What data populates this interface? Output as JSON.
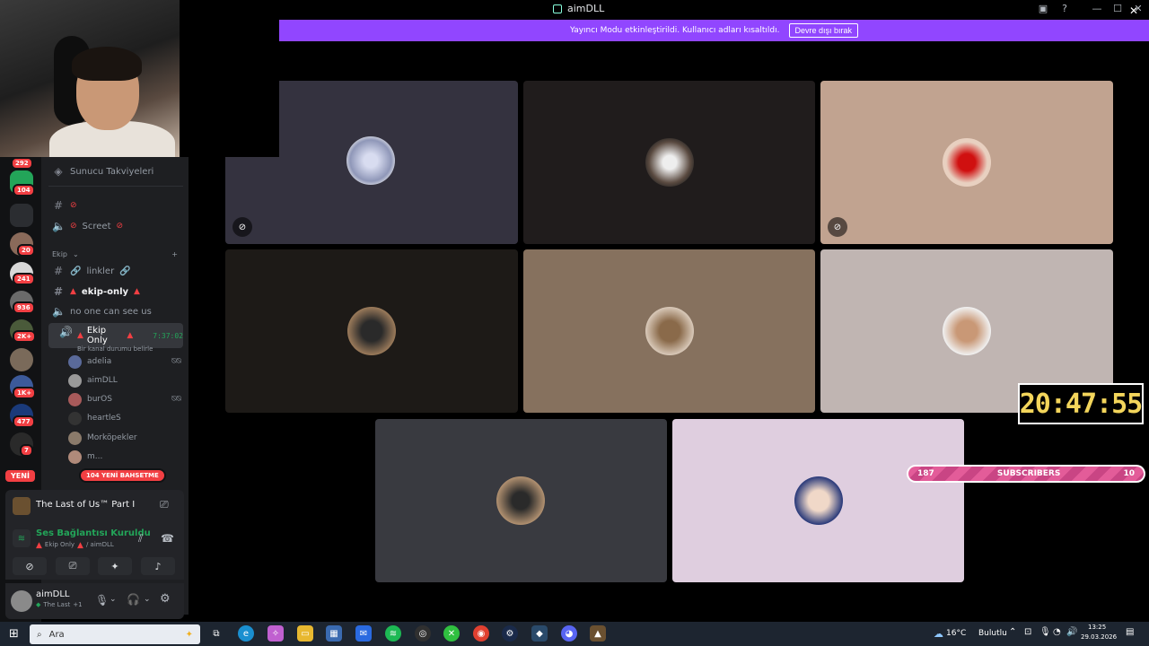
{
  "window": {
    "title": "aimDLL"
  },
  "banner": {
    "message": "Yayıncı Modu etkinleştirildi. Kullanıcı adları kısaltıldı.",
    "button": "Devre dışı bırak"
  },
  "rail": {
    "badges": [
      "292",
      "104",
      "20",
      "241",
      "936",
      "2K+",
      "1K+",
      "477",
      "7"
    ],
    "new_label": "YENİ"
  },
  "sidebar": {
    "boosts": "Sunucu Takviyeleri",
    "category": "Ekip",
    "channels": [
      {
        "name": "",
        "type": "text"
      },
      {
        "name": "Screet",
        "type": "voice"
      },
      {
        "name": "linkler",
        "type": "text"
      },
      {
        "name": "ekip-only",
        "type": "text"
      },
      {
        "name": "no one can see us",
        "type": "voice"
      }
    ],
    "active_voice": {
      "name": "Ekip Only",
      "timer": "7:37:02",
      "status": "Bir kanal durumu belirle"
    },
    "users": [
      "adelia",
      "aimDLL",
      "burOS",
      "heartleS",
      "Morköpekler",
      "m..."
    ],
    "mentions": "104 YENİ BAHSETME"
  },
  "game": {
    "title": "The Last of Us™ Part I"
  },
  "voice": {
    "status": "Ses Bağlantısı Kuruldu",
    "channel": "Ekip Only",
    "server": "/ aimDLL"
  },
  "user": {
    "name": "aimDLL",
    "activity": "The Last",
    "activity_extra": "+1"
  },
  "tiles": [
    {
      "name": "tile-1",
      "bg": "#34323f"
    },
    {
      "name": "tile-2",
      "bg": "#201c1c"
    },
    {
      "name": "tile-3",
      "bg": "#c1a390"
    },
    {
      "name": "tile-4",
      "bg": "#1d1a17"
    },
    {
      "name": "tile-5",
      "bg": "#86715e"
    },
    {
      "name": "tile-6",
      "bg": "#c0b5b2"
    },
    {
      "name": "tile-7",
      "bg": "#393a40"
    },
    {
      "name": "tile-8",
      "bg": "#dfcedf"
    }
  ],
  "overlay": {
    "clock": "20:47:55",
    "subs_left": "187",
    "subs_label": "SUBSCRIBERS",
    "subs_right": "10"
  },
  "taskbar": {
    "search": "Ara",
    "weather": "16°C",
    "weather_label": "Bulutlu",
    "time": "13:25",
    "date": "29.03.2026"
  }
}
